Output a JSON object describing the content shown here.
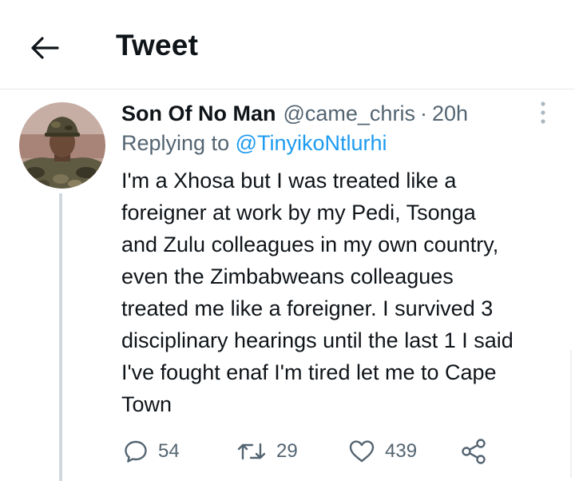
{
  "header": {
    "title": "Tweet",
    "back_icon": "arrow-left-icon"
  },
  "tweet": {
    "author_name": "Son Of No Man",
    "author_handle": "@came_chris",
    "separator": "·",
    "time": "20h",
    "more_icon": "more-vertical-icon",
    "replying_prefix": "Replying to ",
    "replying_to": "@TinyikoNtlurhi",
    "text_lines": [
      "I'm a Xhosa but I was treated like a",
      "foreigner at work by my Pedi, Tsonga",
      "and Zulu colleagues in my own country,",
      "even the Zimbabweans colleagues",
      "treated me like a foreigner. I survived 3",
      "disciplinary hearings until the last 1 I said",
      "I've fought enaf I'm tired let me to Cape",
      "Town"
    ],
    "actions": {
      "reply_count": "54",
      "retweet_count": "29",
      "like_count": "439"
    }
  },
  "colors": {
    "text": "#0f1419",
    "muted": "#536471",
    "link": "#1d9bf0",
    "thread_line": "#cfd9de",
    "divider": "#e6e9ec"
  }
}
